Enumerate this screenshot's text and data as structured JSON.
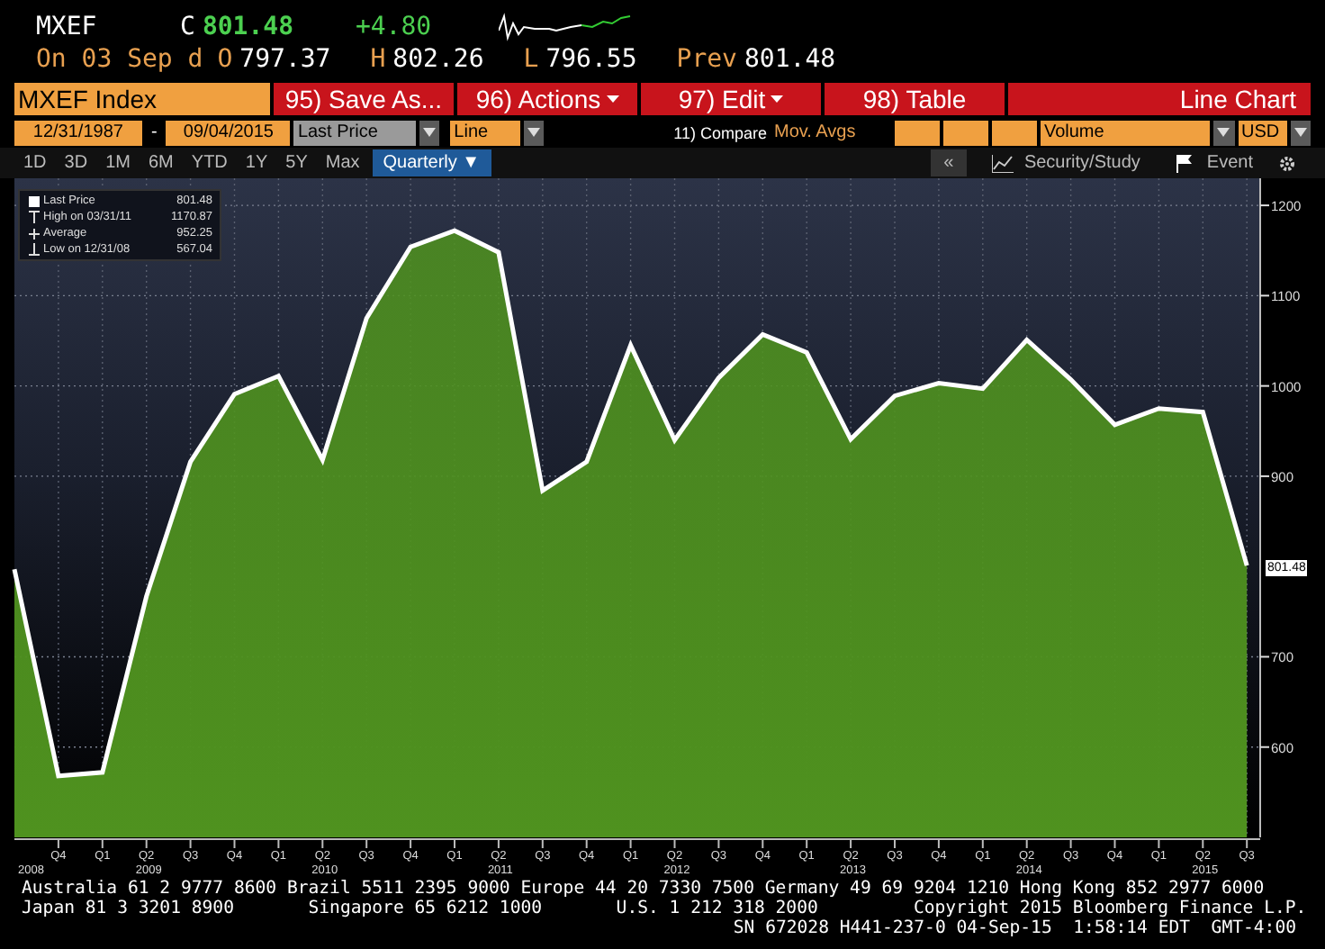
{
  "quote": {
    "ticker": "MXEF",
    "close_label": "C",
    "close": "801.48",
    "change": "+4.80",
    "date": "On 03 Sep d",
    "fields": [
      {
        "label": "O",
        "value": "797.37"
      },
      {
        "label": "H",
        "value": "802.26"
      },
      {
        "label": "L",
        "value": "796.55"
      },
      {
        "label": "Prev",
        "value": "801.48"
      }
    ]
  },
  "toolbar": {
    "security": "MXEF Index",
    "buttons": [
      {
        "label": "95) Save As...",
        "menu": false
      },
      {
        "label": "96) Actions",
        "menu": true
      },
      {
        "label": "97) Edit",
        "menu": true
      },
      {
        "label": "98) Table",
        "menu": false
      }
    ],
    "title": "Line Chart"
  },
  "settings": {
    "start": "12/31/1987",
    "separator": "-",
    "end": "09/04/2015",
    "field": "Last Price",
    "style": "Line",
    "compare": "11) Compare",
    "mov_avgs": "Mov. Avgs",
    "volume": "Volume",
    "currency": "USD"
  },
  "periods": [
    {
      "label": "1D",
      "selected": false
    },
    {
      "label": "3D",
      "selected": false
    },
    {
      "label": "1M",
      "selected": false
    },
    {
      "label": "6M",
      "selected": false
    },
    {
      "label": "YTD",
      "selected": false
    },
    {
      "label": "1Y",
      "selected": false
    },
    {
      "label": "5Y",
      "selected": false
    },
    {
      "label": "Max",
      "selected": false
    },
    {
      "label": "Quarterly ▼",
      "selected": true
    }
  ],
  "right_tools": {
    "collapse": "«",
    "study": "Security/Study",
    "event": "Event"
  },
  "legend": [
    {
      "kind": "square",
      "label": "Last Price",
      "value": "801.48"
    },
    {
      "kind": "high",
      "label": "High on 03/31/11",
      "value": "1170.87"
    },
    {
      "kind": "average",
      "label": "Average",
      "value": "952.25"
    },
    {
      "kind": "low",
      "label": "Low on 12/31/08",
      "value": "567.04"
    }
  ],
  "last_value_label": "801.48",
  "chart_data": {
    "type": "area",
    "categories": [
      null,
      "Q4",
      "Q1",
      "Q2",
      "Q3",
      "Q4",
      "Q1",
      "Q2",
      "Q3",
      "Q4",
      "Q1",
      "Q2",
      "Q3",
      "Q4",
      "Q1",
      "Q2",
      "Q3",
      "Q4",
      "Q1",
      "Q2",
      "Q3",
      "Q4",
      "Q1",
      "Q2",
      "Q3",
      "Q4",
      "Q1",
      "Q2",
      "Q3"
    ],
    "series": [
      {
        "color": "#4f921f",
        "values": [
          797,
          568,
          572,
          767,
          916,
          991,
          1011,
          918,
          1075,
          1154,
          1172,
          1148,
          884,
          916,
          1045,
          940,
          1009,
          1057,
          1037,
          941,
          989,
          1003,
          997,
          1051,
          1007,
          957,
          975,
          971,
          801
        ]
      }
    ],
    "ylim": [
      500,
      1230
    ],
    "yticks": [
      600,
      700,
      900,
      1000,
      1100,
      1200
    ],
    "grid": true,
    "annotations": [
      "2008",
      "2009",
      "2010",
      "2011",
      "2012",
      "2013",
      "2014",
      "2015"
    ]
  },
  "footer": [
    "Australia 61 2 9777 8600 Brazil 5511 2395 9000 Europe 44 20 7330 7500 Germany 49 69 9204 1210 Hong Kong 852 2977 6000",
    "Japan 81 3 3201 8900       Singapore 65 6212 1000       U.S. 1 212 318 2000         Copyright 2015 Bloomberg Finance L.P.",
    "SN 672028 H441-237-0 04-Sep-15  1:58:14 EDT  GMT-4:00"
  ]
}
